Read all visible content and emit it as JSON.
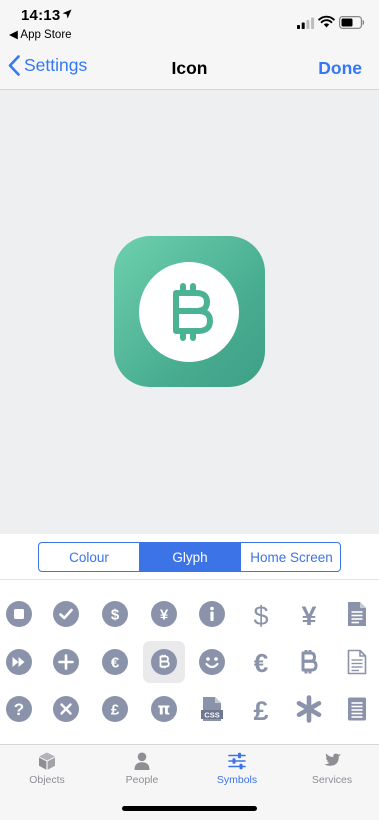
{
  "status_bar": {
    "time": "14:13",
    "back_app": "◀ App Store"
  },
  "nav": {
    "back_label": "Settings",
    "title": "Icon",
    "done_label": "Done"
  },
  "preview": {
    "icon": "bitcoin-icon",
    "background_colors": [
      "#6dd0ad",
      "#3ea086"
    ]
  },
  "segments": [
    {
      "label": "Colour",
      "active": false
    },
    {
      "label": "Glyph",
      "active": true
    },
    {
      "label": "Home Screen",
      "active": false
    }
  ],
  "glyphs": [
    [
      "stop-circle",
      "checkmark-circle",
      "dollar-circle",
      "yen-circle",
      "info-circle",
      "dollar-sign",
      "yen-sign",
      "document"
    ],
    [
      "fast-forward-circle",
      "plus-circle",
      "euro-circle",
      "bitcoin-circle",
      "smiley-circle",
      "euro-sign",
      "bitcoin-sign",
      "document-outline"
    ],
    [
      "question-circle",
      "x-circle",
      "pound-circle",
      "pi-circle",
      "css-file",
      "pound-sign",
      "asterisk",
      "notes"
    ]
  ],
  "selected_glyph": "bitcoin-circle",
  "tabs": [
    {
      "label": "Objects",
      "icon": "cube-icon",
      "active": false
    },
    {
      "label": "People",
      "icon": "person-icon",
      "active": false
    },
    {
      "label": "Symbols",
      "icon": "sliders-icon",
      "active": true
    },
    {
      "label": "Services",
      "icon": "bird-icon",
      "active": false
    }
  ],
  "colors": {
    "accent": "#3c73e6",
    "glyph": "#8a93aa",
    "icon_green": "#4bb394"
  }
}
